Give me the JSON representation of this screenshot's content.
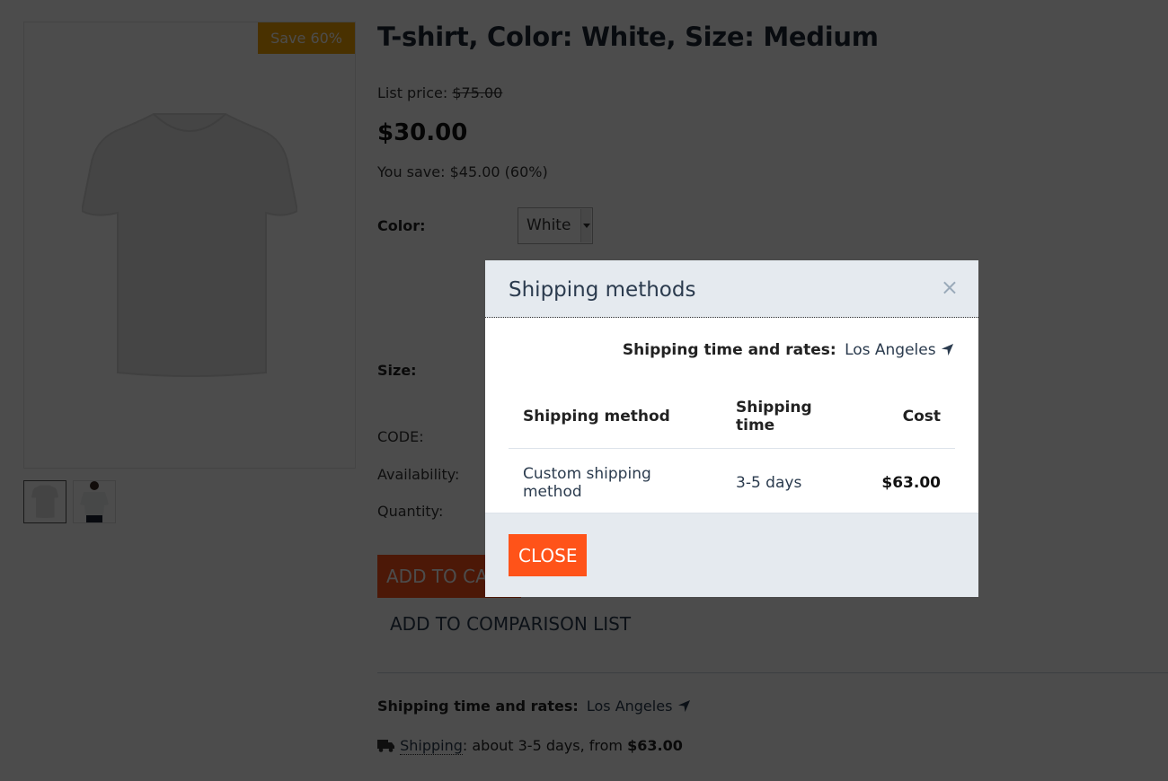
{
  "product": {
    "title": "T-shirt, Color: White, Size: Medium",
    "badge": "Save 60%",
    "list_price_label": "List price:",
    "list_price": "$75.00",
    "price": "$30.00",
    "you_save": "You save: $45.00 (60%)",
    "color_label": "Color:",
    "color_value": "White",
    "size_label": "Size:",
    "code_label": "CODE:",
    "availability_label": "Availability:",
    "quantity_label": "Quantity:",
    "add_to_cart": "ADD TO CART",
    "add_to_comparison": "ADD TO COMPARISON LIST",
    "thumbnails": [
      "T-shirt front",
      "Model wearing T-shirt"
    ]
  },
  "shipping_summary": {
    "rates_label": "Shipping time and rates:",
    "city": "Los Angeles",
    "link": "Shipping",
    "text_middle": ": about 3-5 days, from ",
    "from_price": "$63.00"
  },
  "modal": {
    "title": "Shipping methods",
    "close_icon": "×",
    "rates_label": "Shipping time and rates:",
    "city": "Los Angeles",
    "columns": [
      "Shipping method",
      "Shipping time",
      "Cost"
    ],
    "rows": [
      {
        "method": "Custom shipping method",
        "time": "3-5 days",
        "cost": "$63.00"
      }
    ],
    "close_button": "CLOSE"
  },
  "colors": {
    "accent": "#ff5319",
    "badge": "#f3a300",
    "modal_header_bg": "#e5eaef",
    "overlay": "rgba(0,0,0,0.70)"
  }
}
